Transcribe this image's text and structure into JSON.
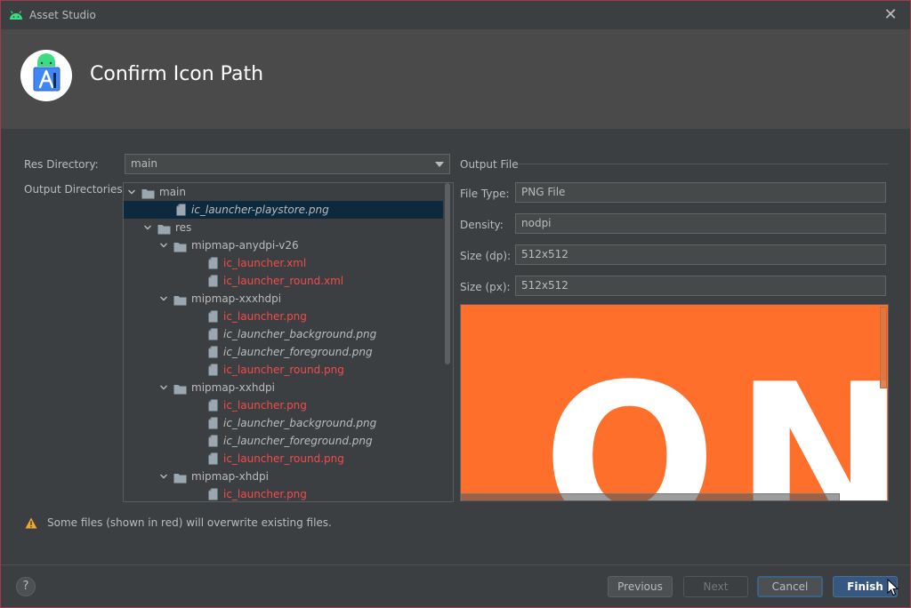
{
  "window": {
    "title": "Asset Studio",
    "close_glyph": "✕",
    "heading": "Confirm Icon Path"
  },
  "form": {
    "res_directory_label": "Res Directory:",
    "res_directory_value": "main",
    "output_directories_label": "Output Directories:"
  },
  "tree": {
    "rows": [
      {
        "text": "main",
        "kind": "folder",
        "level": 0,
        "expanded": true,
        "red": false,
        "italic": false,
        "selected": false
      },
      {
        "text": "ic_launcher-playstore.png",
        "kind": "file",
        "level": 1,
        "red": false,
        "italic": true,
        "selected": true
      },
      {
        "text": "res",
        "kind": "folder",
        "level": 1,
        "expanded": true,
        "red": false,
        "italic": false,
        "selected": false
      },
      {
        "text": "mipmap-anydpi-v26",
        "kind": "folder",
        "level": 2,
        "expanded": true,
        "red": false,
        "italic": false,
        "selected": false
      },
      {
        "text": "ic_launcher.xml",
        "kind": "file",
        "level": 3,
        "red": true,
        "italic": false,
        "selected": false
      },
      {
        "text": "ic_launcher_round.xml",
        "kind": "file",
        "level": 3,
        "red": true,
        "italic": false,
        "selected": false
      },
      {
        "text": "mipmap-xxxhdpi",
        "kind": "folder",
        "level": 2,
        "expanded": true,
        "red": false,
        "italic": false,
        "selected": false
      },
      {
        "text": "ic_launcher.png",
        "kind": "file",
        "level": 3,
        "red": true,
        "italic": false,
        "selected": false
      },
      {
        "text": "ic_launcher_background.png",
        "kind": "file",
        "level": 3,
        "red": false,
        "italic": true,
        "selected": false
      },
      {
        "text": "ic_launcher_foreground.png",
        "kind": "file",
        "level": 3,
        "red": false,
        "italic": true,
        "selected": false
      },
      {
        "text": "ic_launcher_round.png",
        "kind": "file",
        "level": 3,
        "red": true,
        "italic": false,
        "selected": false
      },
      {
        "text": "mipmap-xxhdpi",
        "kind": "folder",
        "level": 2,
        "expanded": true,
        "red": false,
        "italic": false,
        "selected": false
      },
      {
        "text": "ic_launcher.png",
        "kind": "file",
        "level": 3,
        "red": true,
        "italic": false,
        "selected": false
      },
      {
        "text": "ic_launcher_background.png",
        "kind": "file",
        "level": 3,
        "red": false,
        "italic": true,
        "selected": false
      },
      {
        "text": "ic_launcher_foreground.png",
        "kind": "file",
        "level": 3,
        "red": false,
        "italic": true,
        "selected": false
      },
      {
        "text": "ic_launcher_round.png",
        "kind": "file",
        "level": 3,
        "red": true,
        "italic": false,
        "selected": false
      },
      {
        "text": "mipmap-xhdpi",
        "kind": "folder",
        "level": 2,
        "expanded": true,
        "red": false,
        "italic": false,
        "selected": false
      },
      {
        "text": "ic_launcher.png",
        "kind": "file",
        "level": 3,
        "red": true,
        "italic": false,
        "selected": false
      }
    ]
  },
  "output": {
    "section_title": "Output File",
    "fields": [
      {
        "label": "File Type:",
        "value": "PNG File"
      },
      {
        "label": "Density:",
        "value": "nodpi"
      },
      {
        "label": "Size (dp):",
        "value": "512x512"
      },
      {
        "label": "Size (px):",
        "value": "512x512"
      }
    ],
    "preview_text": "ON"
  },
  "warning": {
    "text": "Some files (shown in red) will overwrite existing files."
  },
  "footer": {
    "help_glyph": "?",
    "previous_label": "Previous",
    "next_label": "Next",
    "cancel_label": "Cancel",
    "finish_label": "Finish"
  },
  "colors": {
    "background": "#3c3f41",
    "header": "#4a4a4a",
    "overwrite_red": "#f24b4b",
    "selection": "#0d293e",
    "preview_orange": "#fe6f2b",
    "primary_button": "#365880"
  },
  "icons": [
    "android-icon",
    "close-icon",
    "android-studio-logo-icon",
    "chevron-down-icon",
    "folder-icon",
    "file-icon",
    "warning-icon",
    "help-icon",
    "mouse-cursor-icon"
  ]
}
